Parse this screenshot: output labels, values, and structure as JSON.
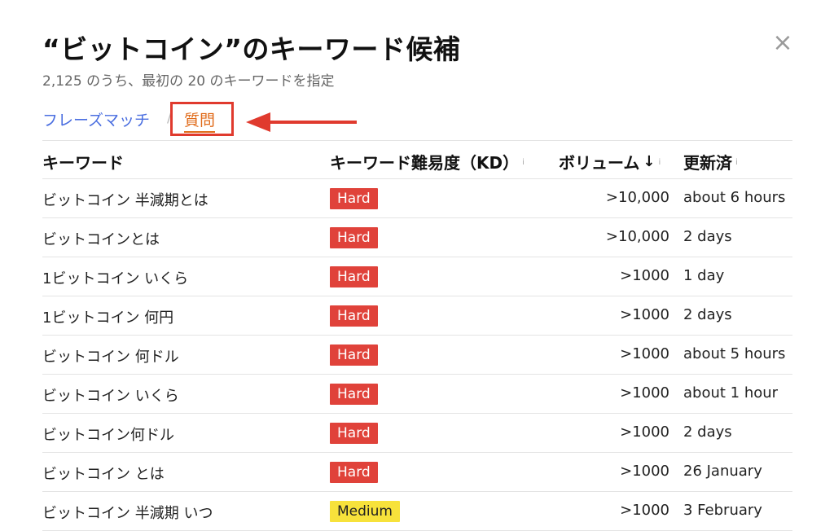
{
  "dialog": {
    "title": "“ビットコイン”のキーワード候補",
    "subtitle": "2,125 のうち、最初の 20 のキーワードを指定",
    "close_label": "×"
  },
  "tabs": {
    "phrase_match": "フレーズマッチ",
    "separator": "/",
    "question": "質問",
    "active": "question"
  },
  "annotation": {
    "highlight_color": "#e03a2e",
    "arrow_color": "#e03a2e"
  },
  "table": {
    "columns": {
      "keyword": "キーワード",
      "kd": "キーワード難易度（KD）",
      "volume": "ボリューム",
      "updated": "更新済"
    },
    "sort_indicator": "↓",
    "info_icon": "i",
    "rows": [
      {
        "keyword": "ビットコイン 半減期とは",
        "kd": "Hard",
        "volume": ">10,000",
        "updated": "about 6 hours"
      },
      {
        "keyword": "ビットコインとは",
        "kd": "Hard",
        "volume": ">10,000",
        "updated": "2 days"
      },
      {
        "keyword": "1ビットコイン いくら",
        "kd": "Hard",
        "volume": ">1000",
        "updated": "1 day"
      },
      {
        "keyword": "1ビットコイン 何円",
        "kd": "Hard",
        "volume": ">1000",
        "updated": "2 days"
      },
      {
        "keyword": "ビットコイン 何ドル",
        "kd": "Hard",
        "volume": ">1000",
        "updated": "about 5 hours"
      },
      {
        "keyword": "ビットコイン いくら",
        "kd": "Hard",
        "volume": ">1000",
        "updated": "about 1 hour"
      },
      {
        "keyword": "ビットコイン何ドル",
        "kd": "Hard",
        "volume": ">1000",
        "updated": "2 days"
      },
      {
        "keyword": "ビットコイン とは",
        "kd": "Hard",
        "volume": ">1000",
        "updated": "26 January"
      },
      {
        "keyword": "ビットコイン 半減期 いつ",
        "kd": "Medium",
        "volume": ">1000",
        "updated": "3 February"
      }
    ]
  },
  "colors": {
    "hard": "#e0423a",
    "medium": "#f7e23b",
    "link": "#4a6ee0",
    "active_tab": "#e06b1a"
  }
}
